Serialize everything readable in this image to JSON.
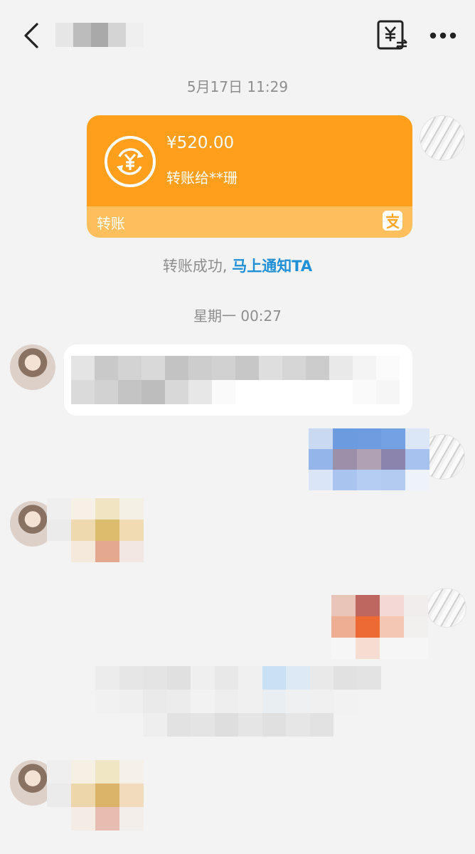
{
  "header": {
    "back_icon": "chevron-left-icon",
    "title_obscured": true,
    "transfer_icon": "yuan-transfer-icon",
    "more_icon": "more-dots-icon"
  },
  "timestamps": [
    "5月17日 11:29",
    "星期一 00:27"
  ],
  "transfer_card": {
    "amount": "¥520.00",
    "recipient": "转账给**珊",
    "label": "转账",
    "brand_icon": "alipay-icon",
    "colors": {
      "primary": "#ff9f1b",
      "footer": "#ffbf5c"
    }
  },
  "status": {
    "text": "转账成功,",
    "link": "马上通知TA",
    "link_color": "#1f8fd6"
  }
}
